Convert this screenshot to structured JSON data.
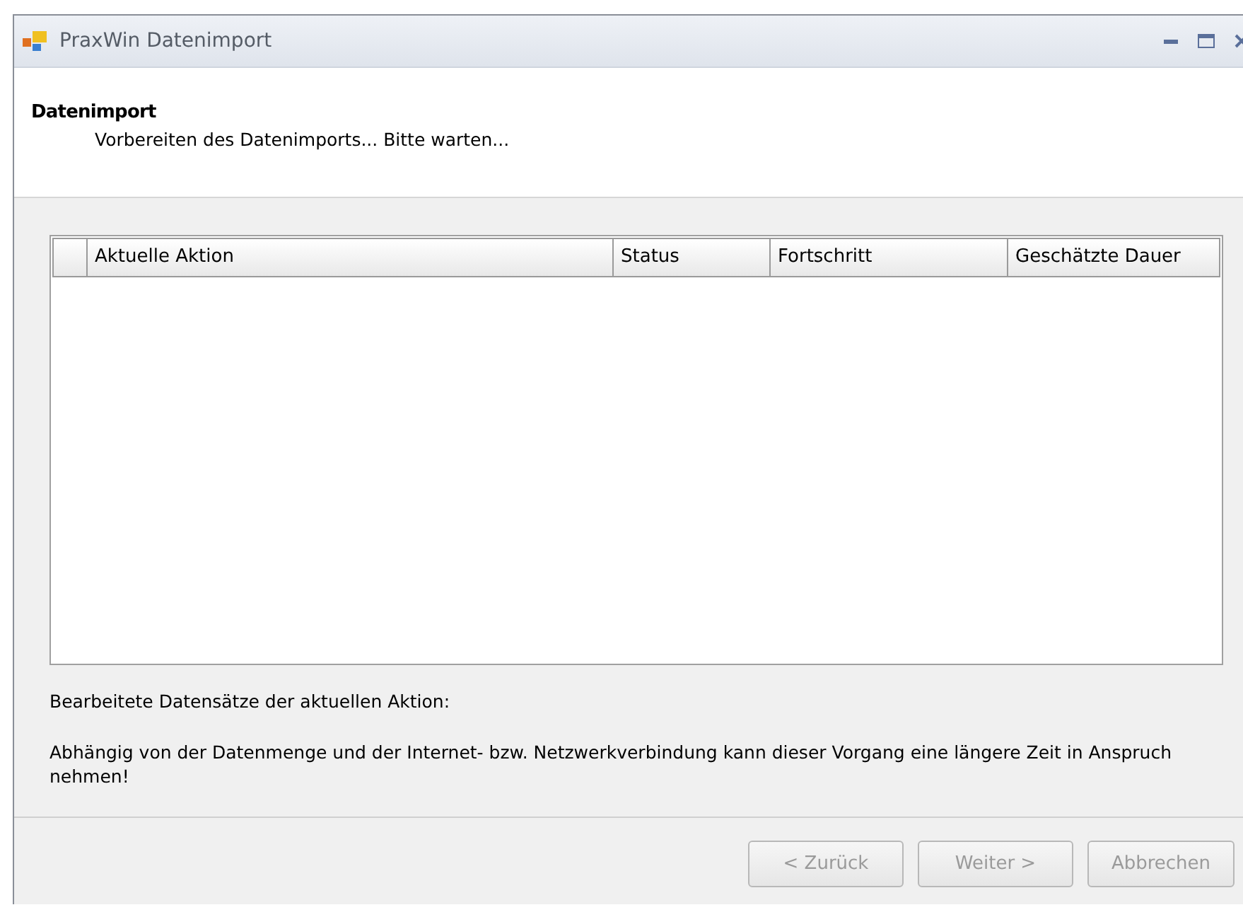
{
  "window": {
    "title": "PraxWin Datenimport"
  },
  "header": {
    "title": "Datenimport",
    "subtitle": "Vorbereiten des Datenimports... Bitte warten..."
  },
  "table": {
    "columns": [
      "Aktuelle Aktion",
      "Status",
      "Fortschritt",
      "Geschätzte Dauer"
    ]
  },
  "processed_label": "Bearbeitete Datensätze der aktuellen Aktion:",
  "notice": "Abhängig von der Datenmenge und der Internet- bzw. Netzwerkverbindung kann dieser Vorgang eine längere Zeit in Anspruch nehmen!",
  "buttons": [
    {
      "label": "< Zurück",
      "disabled": true
    },
    {
      "label": "Weiter >",
      "disabled": true
    },
    {
      "label": "Abbrechen",
      "disabled": true
    }
  ]
}
